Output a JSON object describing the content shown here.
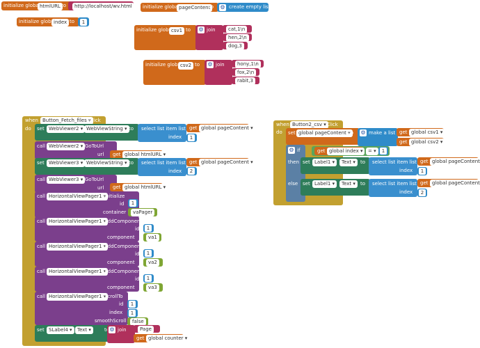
{
  "globals": {
    "init_label": "initialize global",
    "to_label": "to",
    "html_url_name": "htmlURL",
    "html_url_value": "http://localhost/wv.html",
    "page_content_name": "pageContent",
    "create_empty_list": "create empty list",
    "index_name": "index",
    "index_value": "1",
    "csv1_name": "csv1",
    "csv2_name": "csv2",
    "join_label": "join",
    "csv1_items": [
      "cat,1\\n",
      "hen,2\\n",
      "dog,3"
    ],
    "csv2_items": [
      "hony,1\\n",
      "fox,2\\n",
      "rabit,3"
    ]
  },
  "fetch_event": {
    "when_label": "when",
    "component": "Button_Fetch_files",
    "event": "Click",
    "do_label": "do",
    "set_label": "set",
    "call_label": "call",
    "get_label": "get",
    "webviewer2": "WebViewer2",
    "webviewer3": "WebViewer3",
    "webviewstring": "WebViewString",
    "select_list_item": "select list item  list",
    "index_label": "index",
    "get_page_content": "global pageContent",
    "index1": "1",
    "index2": "2",
    "goto_url": "GoToUrl",
    "url_label": "url",
    "get_html_url": "global htmlURL",
    "hvp": "HorizontalViewPager1",
    "initialize": "Initialize",
    "id_label": "id",
    "container_label": "container",
    "container_value": "vaPager",
    "add_component": "AddComponent",
    "component_label": "component",
    "va1": "va1",
    "va2": "va2",
    "va3": "va3",
    "scroll_to": "ScrollTo",
    "smooth_scroll": "smoothScroll",
    "false_label": "false",
    "slabel": "SLabel4",
    "text_label": "Text",
    "page_text": "Page",
    "get_global_counter": "global counter"
  },
  "csv_event": {
    "when_label": "when",
    "component": "Button2_csv",
    "event": "Click",
    "do_label": "do",
    "set_page_content": "global pageContent",
    "make_a_list": "make a list",
    "get_csv1": "global csv1",
    "get_csv2": "global csv2",
    "if_label": "if",
    "then_label": "then",
    "else_label": "else",
    "get_index": "global index",
    "eq": "=",
    "eq_value": "1",
    "label1": "Label1",
    "text_label": "Text",
    "select_list_item": "select list item  list",
    "index_label": "index",
    "then_index": "1",
    "else_index": "2"
  }
}
